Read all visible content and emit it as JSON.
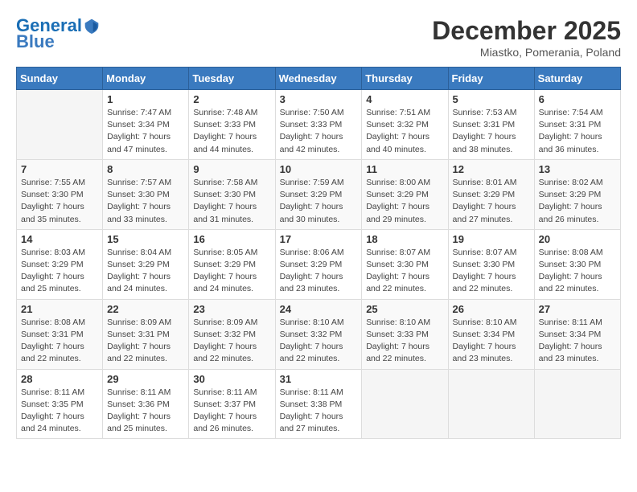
{
  "header": {
    "logo_line1": "General",
    "logo_line2": "Blue",
    "month_title": "December 2025",
    "location": "Miastko, Pomerania, Poland"
  },
  "weekdays": [
    "Sunday",
    "Monday",
    "Tuesday",
    "Wednesday",
    "Thursday",
    "Friday",
    "Saturday"
  ],
  "weeks": [
    [
      {
        "day": "",
        "info": ""
      },
      {
        "day": "1",
        "info": "Sunrise: 7:47 AM\nSunset: 3:34 PM\nDaylight: 7 hours\nand 47 minutes."
      },
      {
        "day": "2",
        "info": "Sunrise: 7:48 AM\nSunset: 3:33 PM\nDaylight: 7 hours\nand 44 minutes."
      },
      {
        "day": "3",
        "info": "Sunrise: 7:50 AM\nSunset: 3:33 PM\nDaylight: 7 hours\nand 42 minutes."
      },
      {
        "day": "4",
        "info": "Sunrise: 7:51 AM\nSunset: 3:32 PM\nDaylight: 7 hours\nand 40 minutes."
      },
      {
        "day": "5",
        "info": "Sunrise: 7:53 AM\nSunset: 3:31 PM\nDaylight: 7 hours\nand 38 minutes."
      },
      {
        "day": "6",
        "info": "Sunrise: 7:54 AM\nSunset: 3:31 PM\nDaylight: 7 hours\nand 36 minutes."
      }
    ],
    [
      {
        "day": "7",
        "info": "Sunrise: 7:55 AM\nSunset: 3:30 PM\nDaylight: 7 hours\nand 35 minutes."
      },
      {
        "day": "8",
        "info": "Sunrise: 7:57 AM\nSunset: 3:30 PM\nDaylight: 7 hours\nand 33 minutes."
      },
      {
        "day": "9",
        "info": "Sunrise: 7:58 AM\nSunset: 3:30 PM\nDaylight: 7 hours\nand 31 minutes."
      },
      {
        "day": "10",
        "info": "Sunrise: 7:59 AM\nSunset: 3:29 PM\nDaylight: 7 hours\nand 30 minutes."
      },
      {
        "day": "11",
        "info": "Sunrise: 8:00 AM\nSunset: 3:29 PM\nDaylight: 7 hours\nand 29 minutes."
      },
      {
        "day": "12",
        "info": "Sunrise: 8:01 AM\nSunset: 3:29 PM\nDaylight: 7 hours\nand 27 minutes."
      },
      {
        "day": "13",
        "info": "Sunrise: 8:02 AM\nSunset: 3:29 PM\nDaylight: 7 hours\nand 26 minutes."
      }
    ],
    [
      {
        "day": "14",
        "info": "Sunrise: 8:03 AM\nSunset: 3:29 PM\nDaylight: 7 hours\nand 25 minutes."
      },
      {
        "day": "15",
        "info": "Sunrise: 8:04 AM\nSunset: 3:29 PM\nDaylight: 7 hours\nand 24 minutes."
      },
      {
        "day": "16",
        "info": "Sunrise: 8:05 AM\nSunset: 3:29 PM\nDaylight: 7 hours\nand 24 minutes."
      },
      {
        "day": "17",
        "info": "Sunrise: 8:06 AM\nSunset: 3:29 PM\nDaylight: 7 hours\nand 23 minutes."
      },
      {
        "day": "18",
        "info": "Sunrise: 8:07 AM\nSunset: 3:30 PM\nDaylight: 7 hours\nand 22 minutes."
      },
      {
        "day": "19",
        "info": "Sunrise: 8:07 AM\nSunset: 3:30 PM\nDaylight: 7 hours\nand 22 minutes."
      },
      {
        "day": "20",
        "info": "Sunrise: 8:08 AM\nSunset: 3:30 PM\nDaylight: 7 hours\nand 22 minutes."
      }
    ],
    [
      {
        "day": "21",
        "info": "Sunrise: 8:08 AM\nSunset: 3:31 PM\nDaylight: 7 hours\nand 22 minutes."
      },
      {
        "day": "22",
        "info": "Sunrise: 8:09 AM\nSunset: 3:31 PM\nDaylight: 7 hours\nand 22 minutes."
      },
      {
        "day": "23",
        "info": "Sunrise: 8:09 AM\nSunset: 3:32 PM\nDaylight: 7 hours\nand 22 minutes."
      },
      {
        "day": "24",
        "info": "Sunrise: 8:10 AM\nSunset: 3:32 PM\nDaylight: 7 hours\nand 22 minutes."
      },
      {
        "day": "25",
        "info": "Sunrise: 8:10 AM\nSunset: 3:33 PM\nDaylight: 7 hours\nand 22 minutes."
      },
      {
        "day": "26",
        "info": "Sunrise: 8:10 AM\nSunset: 3:34 PM\nDaylight: 7 hours\nand 23 minutes."
      },
      {
        "day": "27",
        "info": "Sunrise: 8:11 AM\nSunset: 3:34 PM\nDaylight: 7 hours\nand 23 minutes."
      }
    ],
    [
      {
        "day": "28",
        "info": "Sunrise: 8:11 AM\nSunset: 3:35 PM\nDaylight: 7 hours\nand 24 minutes."
      },
      {
        "day": "29",
        "info": "Sunrise: 8:11 AM\nSunset: 3:36 PM\nDaylight: 7 hours\nand 25 minutes."
      },
      {
        "day": "30",
        "info": "Sunrise: 8:11 AM\nSunset: 3:37 PM\nDaylight: 7 hours\nand 26 minutes."
      },
      {
        "day": "31",
        "info": "Sunrise: 8:11 AM\nSunset: 3:38 PM\nDaylight: 7 hours\nand 27 minutes."
      },
      {
        "day": "",
        "info": ""
      },
      {
        "day": "",
        "info": ""
      },
      {
        "day": "",
        "info": ""
      }
    ]
  ]
}
